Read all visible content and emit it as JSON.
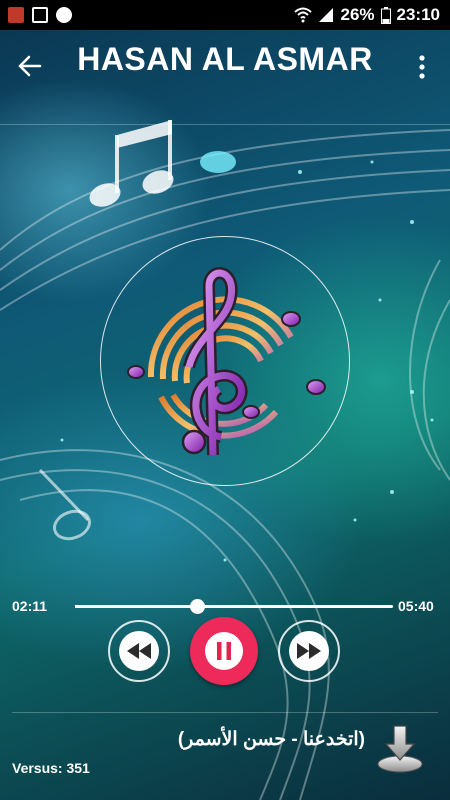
{
  "status_bar": {
    "battery": "26%",
    "time": "23:10",
    "icons": [
      "avatar-notification-icon",
      "image-notification-icon",
      "settings-notification-icon",
      "wifi-icon",
      "signal-icon",
      "battery-icon"
    ]
  },
  "header": {
    "title": "HASAN AL ASMAR",
    "back_icon": "arrow-left-icon",
    "menu_icon": "more-vert-icon"
  },
  "player": {
    "current_time": "02:11",
    "total_time": "05:40",
    "progress_fraction": 0.385,
    "state": "playing",
    "accent_color": "#ee2a5a",
    "controls": [
      "rewind-icon",
      "pause-icon",
      "fast-forward-icon"
    ]
  },
  "track": {
    "title": "(اتخدعنا - حسن الأسمر)",
    "download_icon": "download-icon"
  },
  "footer": {
    "versus": "Versus: 351"
  }
}
